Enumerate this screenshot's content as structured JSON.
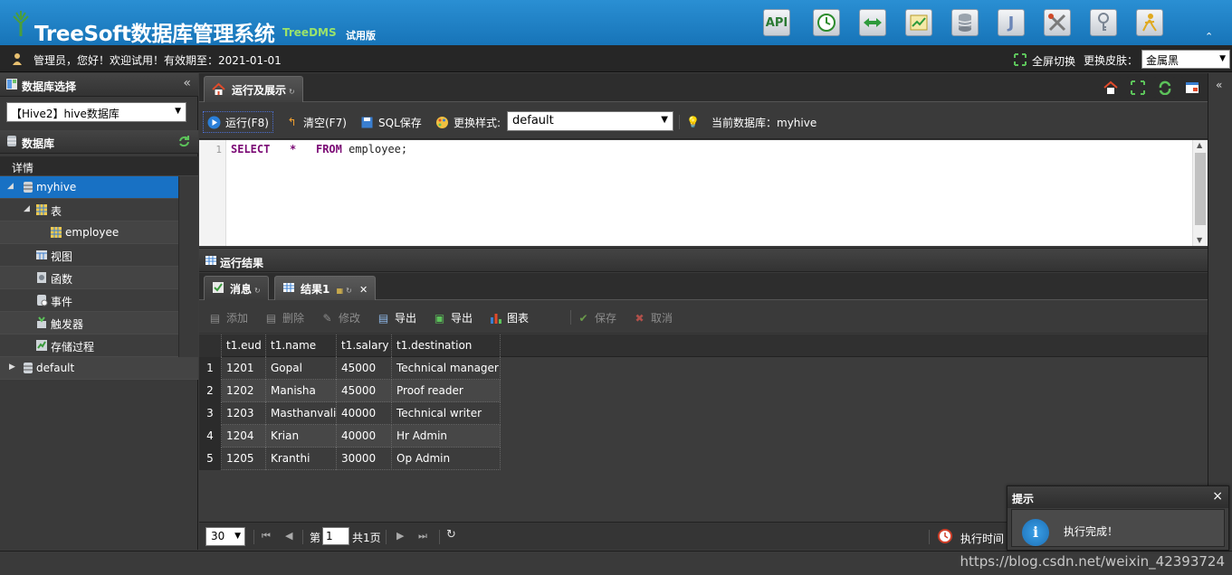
{
  "header": {
    "title": "TreeSoft数据库管理系统",
    "subtitle": "TreeDMS",
    "edition": "试用版",
    "tool_buttons": [
      {
        "name": "api-button",
        "label": "API",
        "icon": "api-icon"
      },
      {
        "name": "schedule-button",
        "label": "",
        "icon": "clock-icon"
      },
      {
        "name": "sync-button",
        "label": "",
        "icon": "arrows-icon"
      },
      {
        "name": "monitor-button",
        "label": "",
        "icon": "chart-check-icon"
      },
      {
        "name": "database-button",
        "label": "",
        "icon": "database-icon"
      },
      {
        "name": "json-button",
        "label": "",
        "icon": "j-icon"
      },
      {
        "name": "tools-button",
        "label": "",
        "icon": "tools-icon"
      },
      {
        "name": "key-button",
        "label": "",
        "icon": "key-icon"
      },
      {
        "name": "user-button",
        "label": "",
        "icon": "user-run-icon"
      }
    ]
  },
  "userbar": {
    "greeting": "管理员，您好！欢迎试用！有效期至：2021-01-01",
    "fullscreen": "全屏切换",
    "skin_label": "更换皮肤：",
    "skin_value": "金属黑"
  },
  "left": {
    "db_select_title": "数据库选择",
    "db_select_value": "【Hive2】hive数据库",
    "db_title": "数据库",
    "detail": "详情",
    "tree": [
      {
        "label": "myhive",
        "level": 0,
        "toggle": "◢",
        "icon": "database-icon",
        "selected": true
      },
      {
        "label": "表",
        "level": 1,
        "toggle": "◢",
        "icon": "table-icon"
      },
      {
        "label": "employee",
        "level": 2,
        "toggle": "",
        "icon": "table-icon"
      },
      {
        "label": "视图",
        "level": 1,
        "toggle": "",
        "icon": "view-icon"
      },
      {
        "label": "函数",
        "level": 1,
        "toggle": "",
        "icon": "function-icon"
      },
      {
        "label": "事件",
        "level": 1,
        "toggle": "",
        "icon": "event-icon"
      },
      {
        "label": "触发器",
        "level": 1,
        "toggle": "",
        "icon": "trigger-icon"
      },
      {
        "label": "存储过程",
        "level": 1,
        "toggle": "",
        "icon": "procedure-icon"
      },
      {
        "label": "default",
        "level": 0,
        "toggle": "▶",
        "icon": "database-icon"
      }
    ]
  },
  "main": {
    "tab_label": "运行及展示",
    "run_label": "运行(F8)",
    "clear_label": "清空(F7)",
    "save_sql_label": "SQL保存",
    "style_label": "更换样式:",
    "style_value": "default",
    "current_db": "当前数据库：myhive",
    "editor": {
      "line": "1",
      "kw1": "SELECT",
      "star": "*",
      "kw2": "FROM",
      "table": "employee;"
    },
    "result_title": "运行结果",
    "result_tabs": {
      "message": "消息",
      "result": "结果1"
    },
    "grid_toolbar": {
      "add": "添加",
      "delete": "删除",
      "modify": "修改",
      "export1": "导出",
      "export2": "导出",
      "chart": "图表",
      "save": "保存",
      "cancel": "取消"
    },
    "columns": [
      "t1.eud",
      "t1.name",
      "t1.salary",
      "t1.destination"
    ],
    "rows": [
      {
        "n": "1",
        "cells": [
          "1201",
          "Gopal",
          "45000",
          "Technical manager"
        ]
      },
      {
        "n": "2",
        "cells": [
          "1202",
          "Manisha",
          "45000",
          "Proof reader"
        ]
      },
      {
        "n": "3",
        "cells": [
          "1203",
          "Masthanvali",
          "40000",
          "Technical writer"
        ]
      },
      {
        "n": "4",
        "cells": [
          "1204",
          "Krian",
          "40000",
          "Hr Admin"
        ]
      },
      {
        "n": "5",
        "cells": [
          "1205",
          "Kranthi",
          "30000",
          "Op Admin"
        ]
      }
    ],
    "pager": {
      "page_size": "30",
      "page_prefix": "第",
      "page_value": "1",
      "page_total": "共1页",
      "exec_time": "执行时间"
    }
  },
  "toast": {
    "title": "提示",
    "close": "×",
    "message": "执行完成！"
  },
  "watermark": "https://blog.csdn.net/weixin_42393724"
}
